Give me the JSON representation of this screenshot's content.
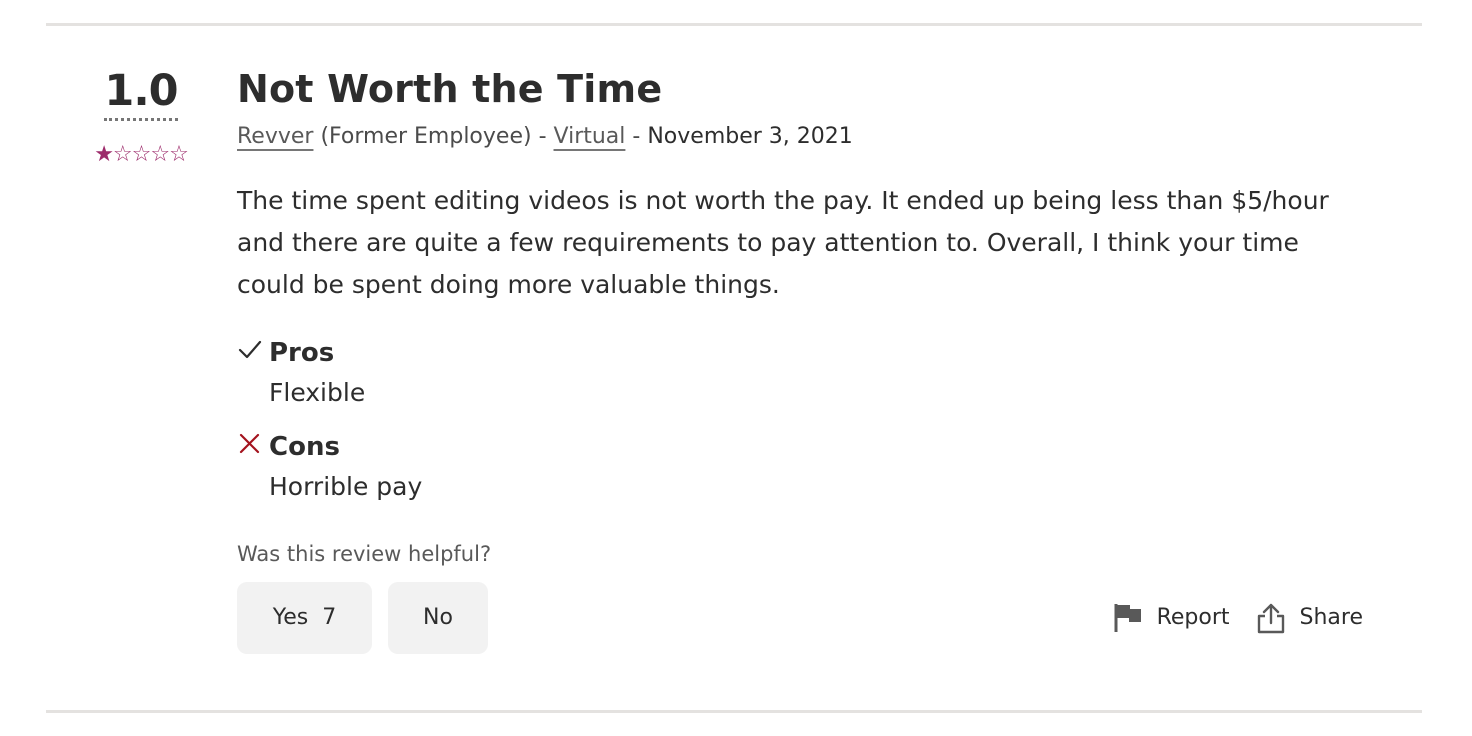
{
  "review": {
    "rating": "1.0",
    "stars": "★☆☆☆☆",
    "title": "Not Worth the Time",
    "company": "Revver",
    "role": "(Former Employee)",
    "separator": " - ",
    "location": "Virtual",
    "date": "November 3, 2021",
    "body": "The time spent editing videos is not worth the pay. It ended up being less than $5/hour and there are quite a few requirements to pay attention to. Overall, I think your time could be spent doing more valuable things.",
    "pros": {
      "heading": "Pros",
      "text": "Flexible"
    },
    "cons": {
      "heading": "Cons",
      "text": "Horrible pay"
    }
  },
  "feedback": {
    "question": "Was this review helpful?",
    "yes_label": "Yes",
    "yes_count": "7",
    "no_label": "No",
    "report_label": "Report",
    "share_label": "Share"
  },
  "icons": {
    "pros": "check-icon",
    "cons": "x-icon",
    "report": "flag-icon",
    "share": "share-icon"
  },
  "colors": {
    "star": "#9d2b6b",
    "cons_mark": "#a4131e",
    "divider": "#e4e2e0",
    "button_bg": "#f2f2f2"
  }
}
